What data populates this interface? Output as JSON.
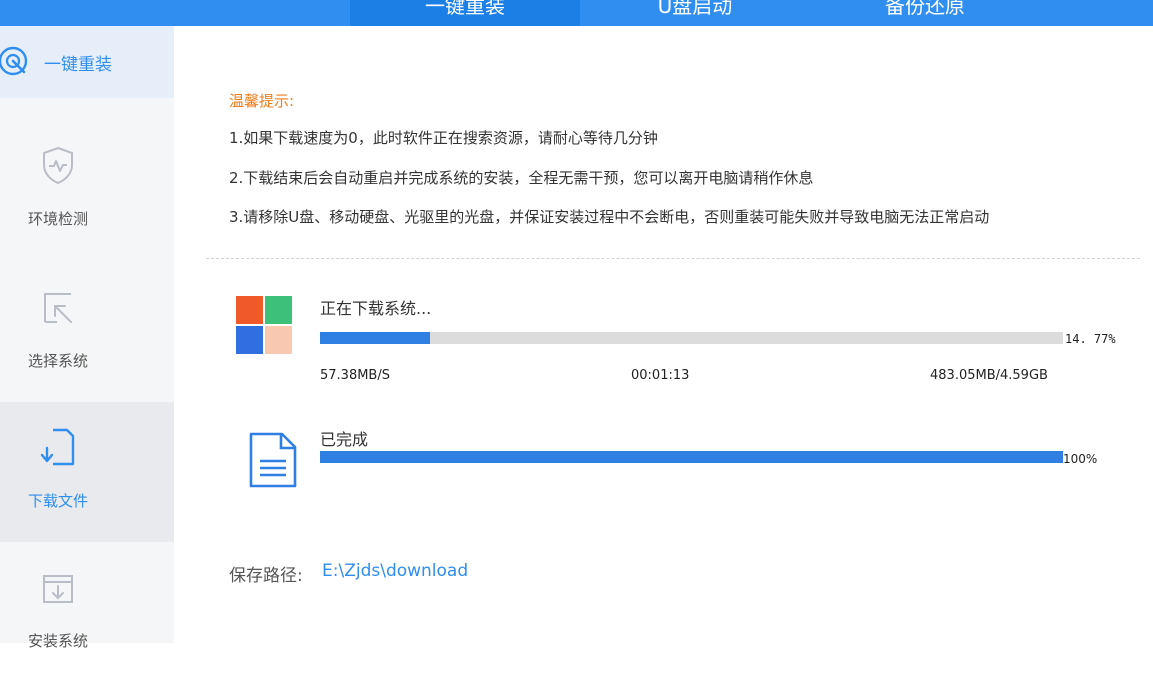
{
  "top_tabs": [
    {
      "label": "一键重装",
      "active": true
    },
    {
      "label": "U盘启动",
      "active": false
    },
    {
      "label": "备份还原",
      "active": false
    }
  ],
  "sidebar": {
    "items": [
      {
        "label": "一键重装",
        "icon": "reinstall-icon"
      },
      {
        "label": "环境检测",
        "icon": "shield-icon"
      },
      {
        "label": "选择系统",
        "icon": "cursor-select-icon"
      },
      {
        "label": "下载文件",
        "icon": "download-file-icon"
      },
      {
        "label": "安装系统",
        "icon": "install-box-icon"
      }
    ],
    "active_step": "下载文件"
  },
  "tips": {
    "title": "温馨提示:",
    "lines": [
      "1.如果下载速度为0，此时软件正在搜索资源，请耐心等待几分钟",
      "2.下载结束后会自动重启并完成系统的安装，全程无需干预，您可以离开电脑请稍作休息",
      "3.请移除U盘、移动硬盘、光驱里的光盘，并保证安装过程中不会断电，否则重装可能失败并导致电脑无法正常启动"
    ]
  },
  "downloads": [
    {
      "title": "正在下载系统...",
      "percent_label": "14. 77%",
      "progress": 0.1477,
      "speed": "57.38MB/S",
      "elapsed": "00:01:13",
      "size": "483.05MB/4.59GB",
      "icon": "windows-logo-icon"
    },
    {
      "title": "已完成",
      "percent_label": "100%",
      "progress": 1.0,
      "icon": "document-icon"
    }
  ],
  "save": {
    "label": "保存路径:",
    "path": "E:\\Zjds\\download"
  },
  "colors": {
    "accent": "#2f8ef0",
    "tip_title": "#f07d1c",
    "progress": "#2f80e2",
    "progress_track": "#dcdcdc"
  }
}
